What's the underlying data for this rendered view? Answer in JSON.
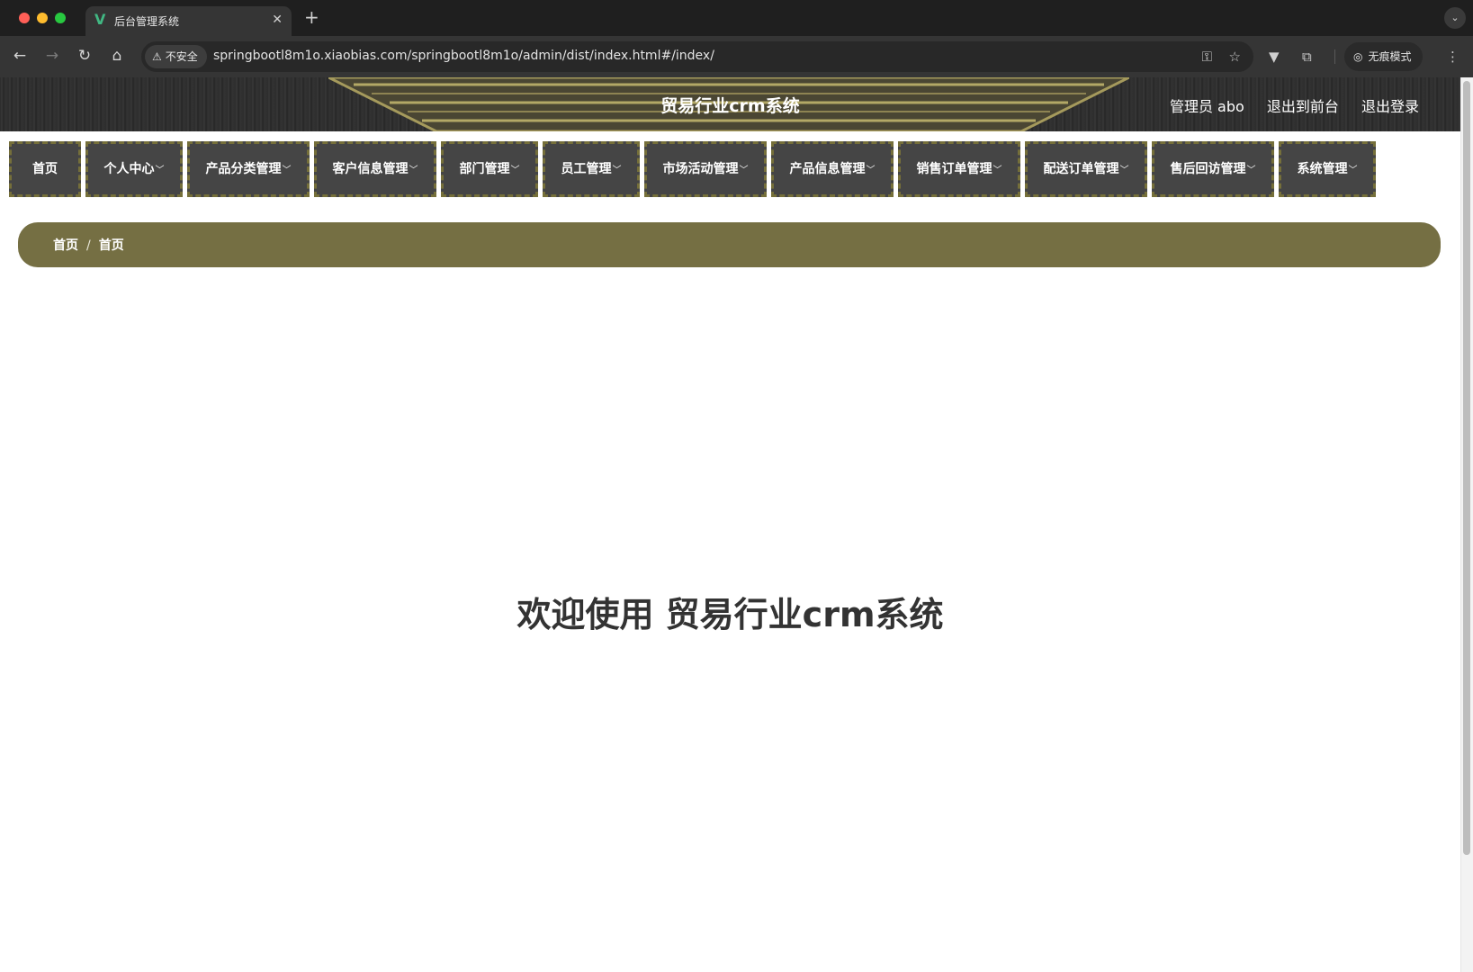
{
  "browser": {
    "tab_title": "后台管理系统",
    "tab_close": "✕",
    "new_tab": "+",
    "security_label": "不安全",
    "url": "springbootl8m1o.xiaobias.com/springbootl8m1o/admin/dist/index.html#/index/",
    "incognito_label": "无痕模式"
  },
  "header": {
    "title": "贸易行业crm系统",
    "user_label": "管理员 abo",
    "front_link": "退出到前台",
    "logout_link": "退出登录"
  },
  "menu": [
    {
      "label": "首页",
      "has_dropdown": false
    },
    {
      "label": "个人中心",
      "has_dropdown": true
    },
    {
      "label": "产品分类管理",
      "has_dropdown": true
    },
    {
      "label": "客户信息管理",
      "has_dropdown": true
    },
    {
      "label": "部门管理",
      "has_dropdown": true
    },
    {
      "label": "员工管理",
      "has_dropdown": true
    },
    {
      "label": "市场活动管理",
      "has_dropdown": true
    },
    {
      "label": "产品信息管理",
      "has_dropdown": true
    },
    {
      "label": "销售订单管理",
      "has_dropdown": true
    },
    {
      "label": "配送订单管理",
      "has_dropdown": true
    },
    {
      "label": "售后回访管理",
      "has_dropdown": true
    },
    {
      "label": "系统管理",
      "has_dropdown": true
    }
  ],
  "breadcrumb": {
    "items": [
      "首页",
      "首页"
    ],
    "separator": "/"
  },
  "welcome": {
    "text": "欢迎使用 贸易行业crm系统"
  },
  "colors": {
    "menu_bg": "#454545",
    "menu_border": "#756f3a",
    "breadcrumb_bg": "#756f43",
    "header_bg": "#2e2e2e"
  }
}
